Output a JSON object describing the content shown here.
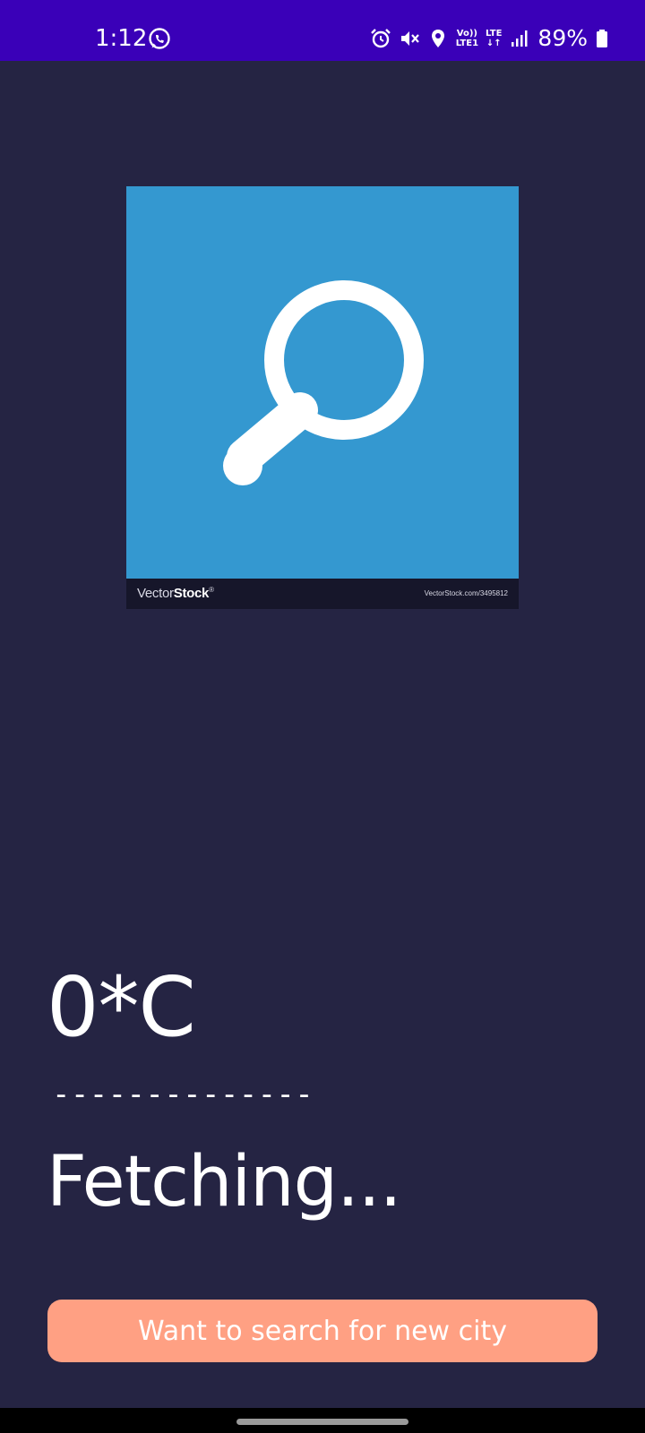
{
  "status_bar": {
    "time": "1:12",
    "network_top": "Vo))",
    "network_bottom": "LTE1",
    "lte_top": "LTE",
    "lte_bottom": "↓↑",
    "battery": "89%",
    "background_color": "#3a00b8",
    "icons": [
      "whatsapp-icon",
      "alarm-icon",
      "mute-icon",
      "location-icon",
      "signal-icon",
      "battery-icon"
    ]
  },
  "search_image": {
    "icon": "search-icon",
    "background_color": "#3498d0",
    "watermark_logo_light": "Vector",
    "watermark_logo_bold": "Stock",
    "watermark_mark": "®",
    "watermark_url": "VectorStock.com/3495812"
  },
  "weather": {
    "temperature": "0*C",
    "divider": "--------------",
    "status": "Fetching..."
  },
  "actions": {
    "search_city_label": "Want to search for new city",
    "button_color": "#ffa083"
  },
  "theme": {
    "background": "#252443"
  }
}
